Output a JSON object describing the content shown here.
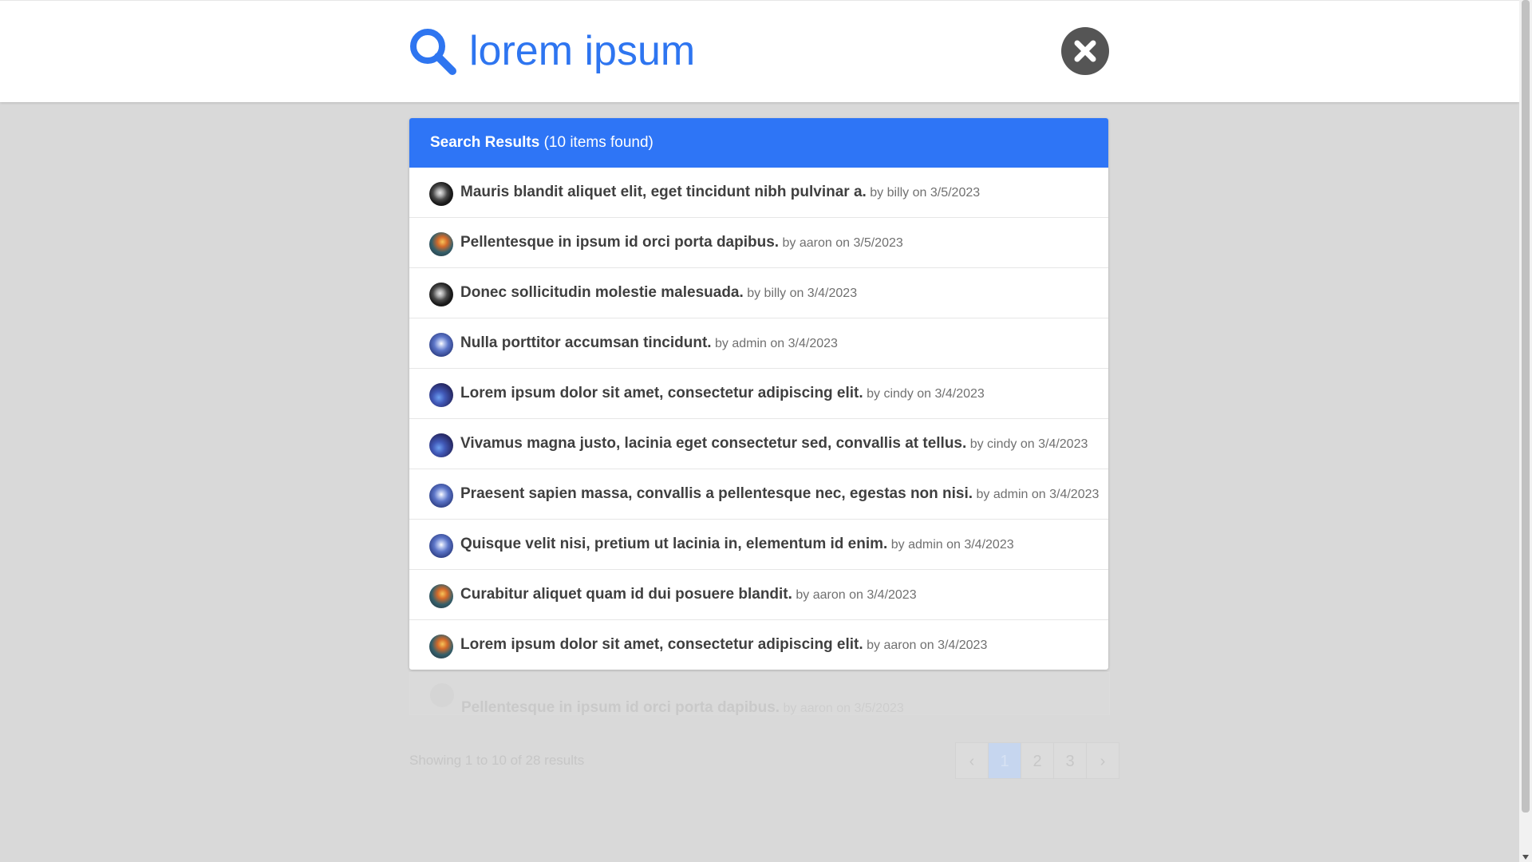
{
  "search": {
    "query": "lorem ipsum",
    "close_icon": "close-icon",
    "search_icon": "search-icon"
  },
  "results": {
    "header_bold": "Search Results",
    "header_count": " (10 items found)",
    "items": [
      {
        "title": "Mauris blandit aliquet elit, eget tincidunt nibh pulvinar a.",
        "meta": " by billy on 3/5/2023",
        "avatar": "galaxy"
      },
      {
        "title": "Pellentesque in ipsum id orci porta dapibus.",
        "meta": " by aaron on 3/5/2023",
        "avatar": "nebula"
      },
      {
        "title": "Donec sollicitudin molestie malesuada.",
        "meta": " by billy on 3/4/2023",
        "avatar": "galaxy"
      },
      {
        "title": "Nulla porttitor accumsan tincidunt.",
        "meta": " by admin on 3/4/2023",
        "avatar": "blue"
      },
      {
        "title": "Lorem ipsum dolor sit amet, consectetur adipiscing elit.",
        "meta": " by cindy on 3/4/2023",
        "avatar": "space"
      },
      {
        "title": "Vivamus magna justo, lacinia eget consectetur sed, convallis at tellus.",
        "meta": " by cindy on 3/4/2023",
        "avatar": "space"
      },
      {
        "title": "Praesent sapien massa, convallis a pellentesque nec, egestas non nisi.",
        "meta": " by admin on 3/4/2023",
        "avatar": "blue"
      },
      {
        "title": "Quisque velit nisi, pretium ut lacinia in, elementum id enim.",
        "meta": " by admin on 3/4/2023",
        "avatar": "blue"
      },
      {
        "title": "Curabitur aliquet quam id dui posuere blandit.",
        "meta": " by aaron on 3/4/2023",
        "avatar": "nebula"
      },
      {
        "title": "Lorem ipsum dolor sit amet, consectetur adipiscing elit.",
        "meta": " by aaron on 3/4/2023",
        "avatar": "nebula"
      }
    ]
  },
  "background": {
    "ghost_title": "Pellentesque in ipsum id orci porta dapibus.",
    "ghost_meta": " by aaron on 3/5/2023",
    "showing": "Showing 1 to 10 of 28 results",
    "pager": {
      "prev": "‹",
      "pages": [
        "1",
        "2",
        "3"
      ],
      "next": "›",
      "active": "1"
    }
  },
  "colors": {
    "accent": "#2e75f6",
    "overlay": "#d9d9d9",
    "close_button": "#555555"
  }
}
